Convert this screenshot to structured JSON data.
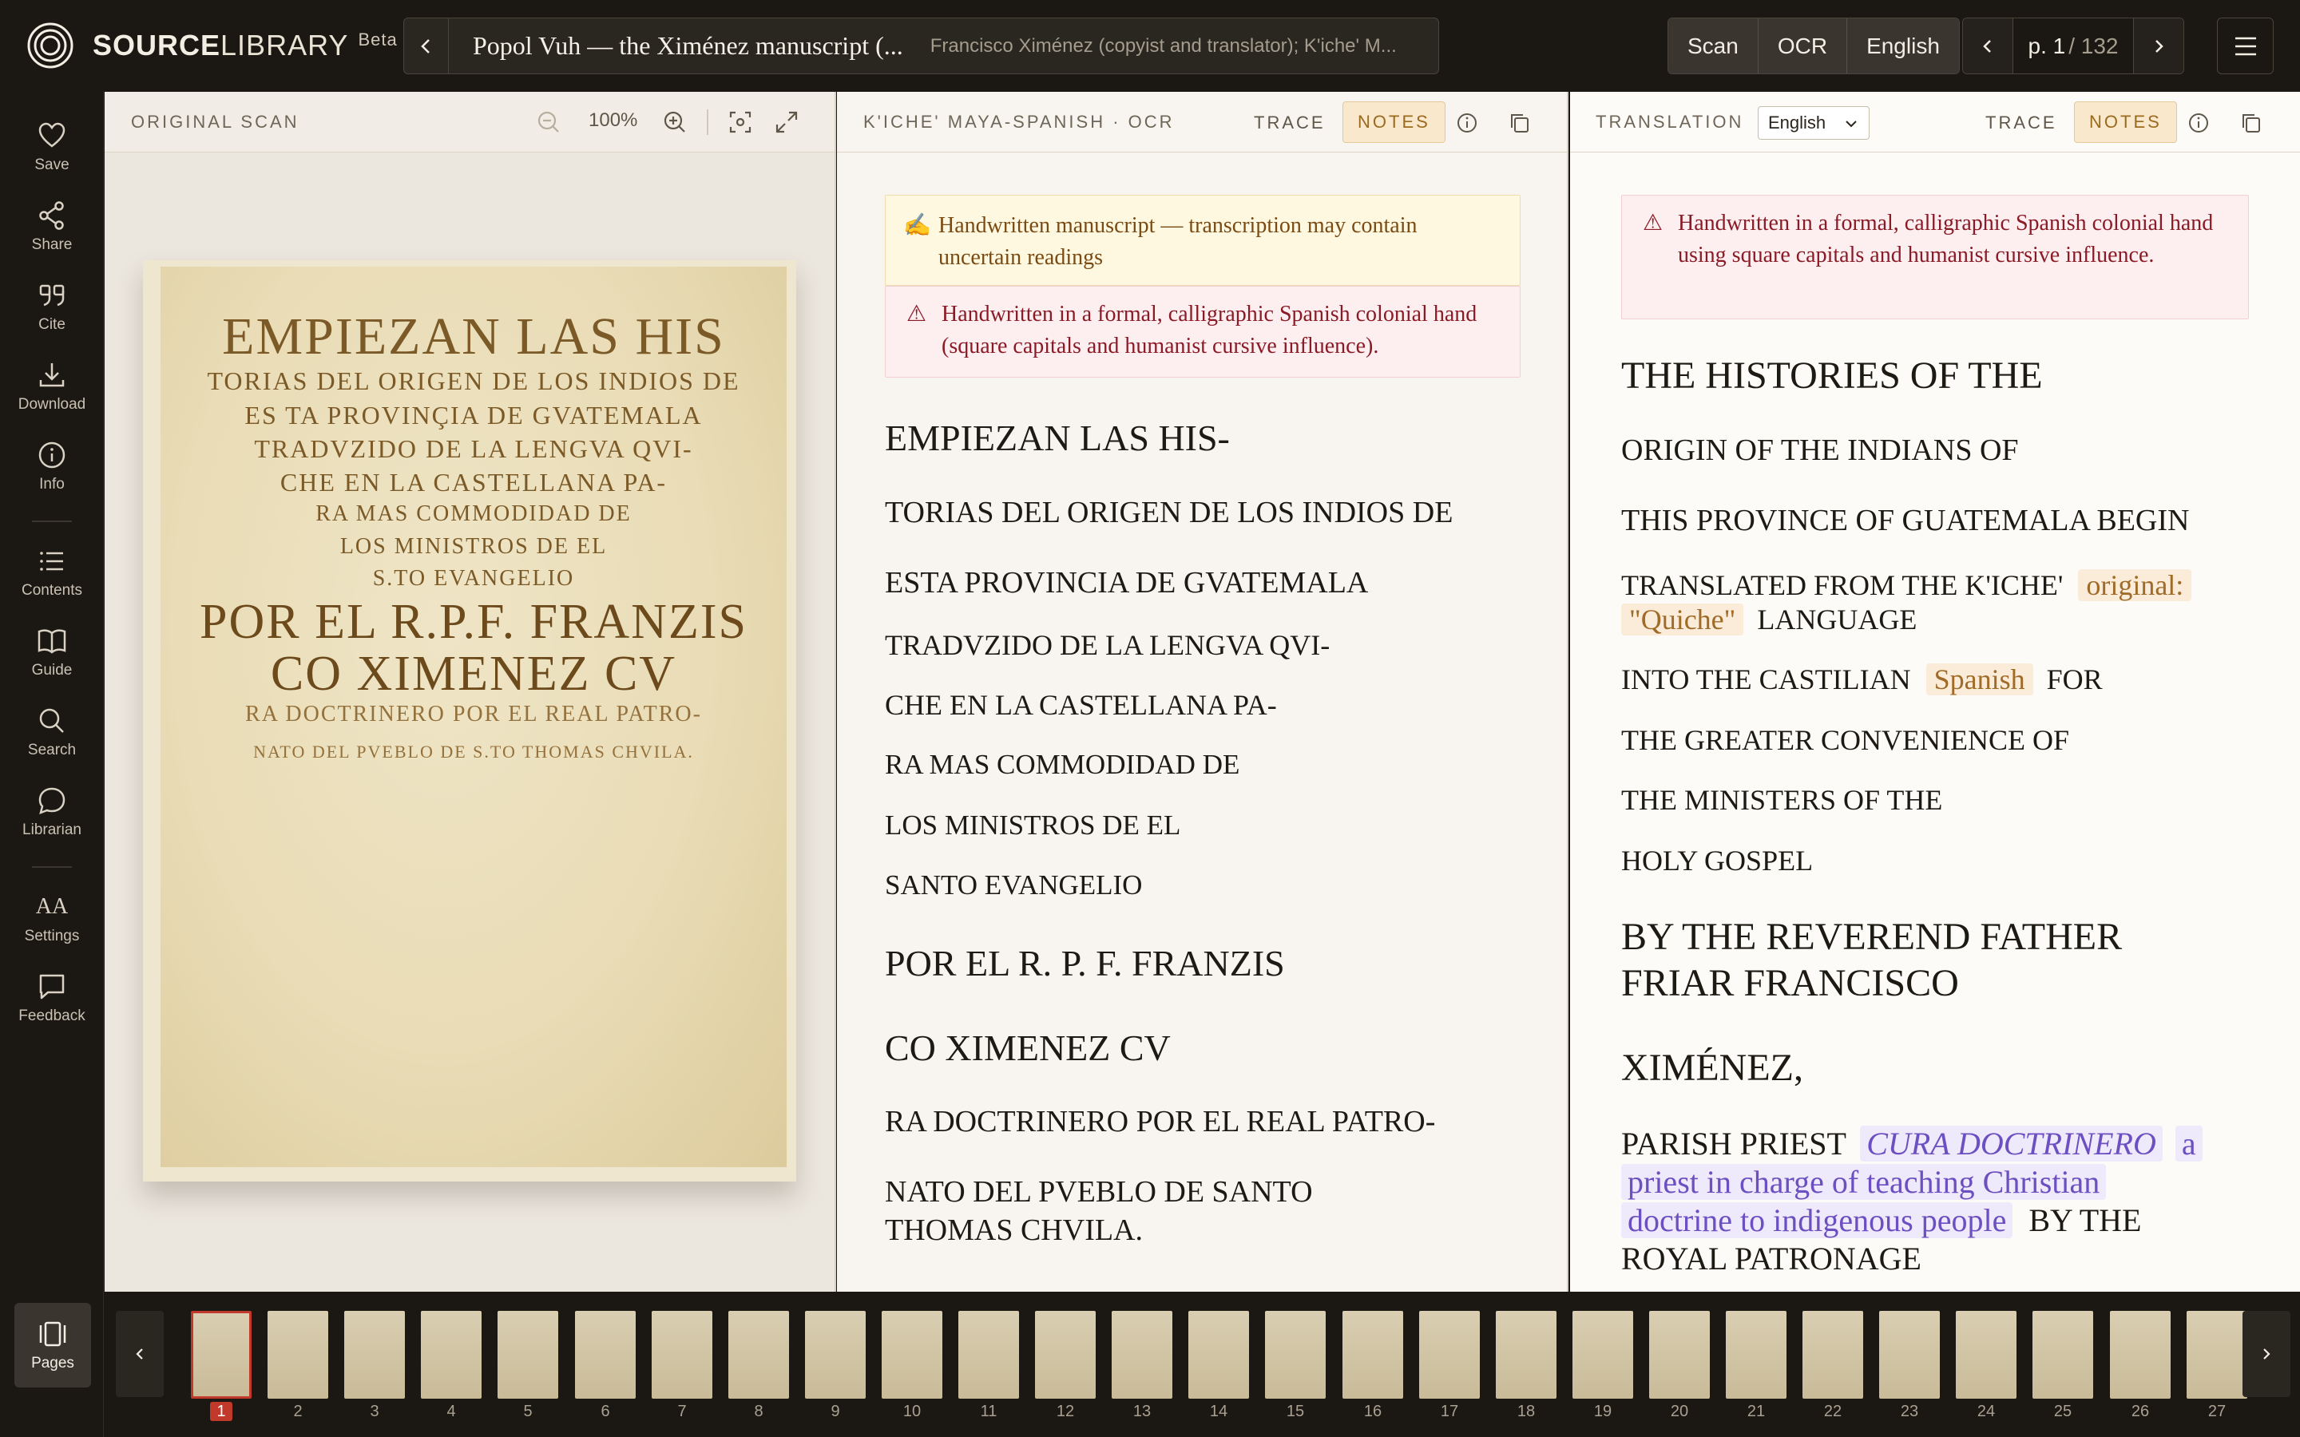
{
  "app": {
    "brand_bold": "SOURCE",
    "brand_light": "LIBRARY",
    "badge": "Beta"
  },
  "doc": {
    "title": "Popol Vuh — the Ximénez manuscript (...",
    "subtitle": "Francisco Ximénez (copyist and translator); K'iche' M..."
  },
  "modes": {
    "scan": "Scan",
    "ocr": "OCR",
    "lang": "English"
  },
  "pager": {
    "current": "p. 1",
    "total": "/ 132"
  },
  "rail": {
    "save": "Save",
    "share": "Share",
    "cite": "Cite",
    "download": "Download",
    "info": "Info",
    "contents": "Contents",
    "guide": "Guide",
    "search": "Search",
    "librarian": "Librarian",
    "settings": "Settings",
    "feedback": "Feedback",
    "pages": "Pages",
    "aa": "AA"
  },
  "scan_panel": {
    "title": "ORIGINAL SCAN",
    "zoom": "100%"
  },
  "ocr_panel": {
    "title": "K'ICHE' MAYA-SPANISH · OCR",
    "trace": "TRACE",
    "notes": "NOTES",
    "notice_yellow": "Handwritten manuscript — transcription may contain uncertain readings",
    "notice_red": "Handwritten in a formal, calligraphic Spanish colonial hand (square capitals and humanist cursive influence).",
    "lines": [
      "EMPIEZAN LAS HIS-",
      "TORIAS DEL ORIGEN DE LOS INDIOS DE",
      "ESTA PROVINCIA DE GVATEMALA",
      "TRADVZIDO DE LA LENGVA QVI-",
      "CHE EN LA CASTELLANA PA-",
      "RA MAS COMMODIDAD DE",
      "LOS MINISTROS DE EL",
      "SANTO EVANGELIO",
      "POR EL R. P. F. FRANZIS",
      "CO XIMENEZ CV",
      "RA DOCTRINERO POR EL REAL PATRO-",
      "NATO DEL PVEBLO DE SANTO",
      "THOMAS CHVILA."
    ]
  },
  "translation_panel": {
    "title": "TRANSLATION",
    "lang_value": "English",
    "trace": "TRACE",
    "notes": "NOTES",
    "notice_red": "Handwritten in a formal, calligraphic Spanish colonial hand using square capitals and humanist cursive influence.",
    "l1": "THE HISTORIES OF THE",
    "l2": "ORIGIN OF THE INDIANS OF",
    "l3": "THIS PROVINCE OF GUATEMALA BEGIN",
    "l4a": "TRANSLATED FROM THE K'ICHE'",
    "l4_note1": "original:",
    "l4_note2": "\"Quiche\"",
    "l4b": "LANGUAGE",
    "l5a": "INTO THE CASTILIAN",
    "l5_note": "Spanish",
    "l5b": "FOR",
    "l6": "THE GREATER CONVENIENCE OF",
    "l7": "THE MINISTERS OF THE",
    "l8": "HOLY GOSPEL",
    "l9": "BY THE REVEREND FATHER",
    "l10": "FRIAR FRANCISCO",
    "l11": "XIMÉNEZ,",
    "l12a": "PARISH PRIEST",
    "l12_term": "CURA DOCTRINERO",
    "l12_gloss1": "a",
    "l12_gloss2": "priest in charge of teaching Christian",
    "l12_gloss3": "doctrine to indigenous people",
    "l12b": "BY THE",
    "l13": "ROYAL PATRONAGE"
  },
  "scan_text": {
    "l1": "EMPIEZAN LAS HIS",
    "l2": "TORIAS DEL ORIGEN DE LOS INDIOS DE",
    "l3": "ES TA PROVINÇIA DE GVATEMALA",
    "l4": "TRADVZIDO DE LA LENGVA QVI-",
    "l5": "CHE EN LA CASTELLANA PA-",
    "l6": "RA MAS COMMODIDAD DE",
    "l7": "LOS MINISTROS DE EL",
    "l8": "S.TO EVANGELIO",
    "l9": "POR EL R.P.F. FRANZIS",
    "l10": "CO XIMENEZ CV",
    "l11": "RA DOCTRINERO POR EL REAL PATRO-",
    "l12": "NATO DEL PVEBLO DE S.TO THOMAS CHVILA."
  },
  "filmstrip": {
    "pages": [
      "1",
      "2",
      "3",
      "4",
      "5",
      "6",
      "7",
      "8",
      "9",
      "10",
      "11",
      "12",
      "13",
      "14",
      "15",
      "16",
      "17",
      "18",
      "19",
      "20",
      "21",
      "22",
      "23",
      "24",
      "25",
      "26",
      "27"
    ],
    "active": "1"
  },
  "colors": {
    "accent": "#c0392b",
    "notes": "#9a6a1e",
    "gloss": "#6c4fc0",
    "bar": "#1b1813"
  }
}
